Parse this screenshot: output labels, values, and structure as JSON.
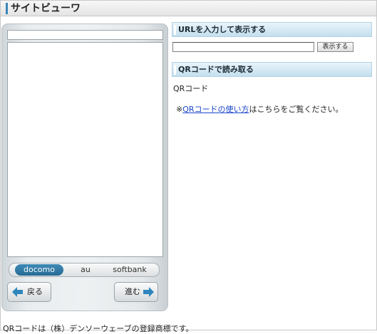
{
  "window": {
    "title": "サイトビューワ"
  },
  "viewer": {
    "carriers": [
      {
        "label": "docomo",
        "active": true
      },
      {
        "label": "au",
        "active": false
      },
      {
        "label": "softbank",
        "active": false
      }
    ],
    "back_label": "戻る",
    "forward_label": "進む"
  },
  "url_section": {
    "heading": "URLを入力して表示する",
    "input_value": "",
    "button_label": "表示する"
  },
  "qr_section": {
    "heading": "QRコードで読み取る",
    "label": "QRコード",
    "note_prefix": "※",
    "note_link": "QRコードの使い方",
    "note_suffix": "はこちらをご覧ください。"
  },
  "footer": {
    "text": "QRコードは（株）デンソーウェーブの登録商標です。"
  },
  "colors": {
    "accent": "#3a86b8",
    "section_bg": "#c3dfef",
    "active_carrier": "#256b95",
    "link": "#1a45c8"
  }
}
